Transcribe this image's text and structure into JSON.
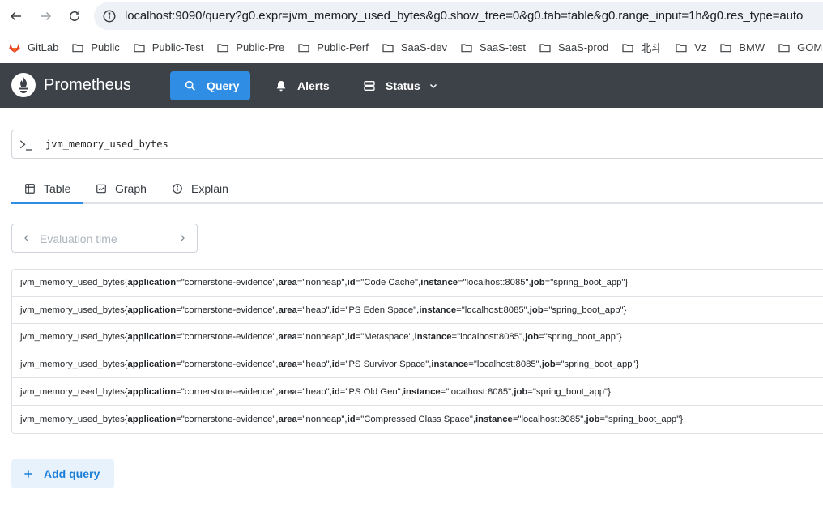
{
  "browser": {
    "url": "localhost:9090/query?g0.expr=jvm_memory_used_bytes&g0.show_tree=0&g0.tab=table&g0.range_input=1h&g0.res_type=auto",
    "bookmarks": [
      "GitLab",
      "Public",
      "Public-Test",
      "Public-Pre",
      "Public-Perf",
      "SaaS-dev",
      "SaaS-test",
      "SaaS-prod",
      "北斗",
      "Vz",
      "BMW",
      "GOM"
    ]
  },
  "navbar": {
    "brand": "Prometheus",
    "query_label": "Query",
    "alerts_label": "Alerts",
    "status_label": "Status"
  },
  "query": {
    "expression": "jvm_memory_used_bytes"
  },
  "tabs": {
    "table": "Table",
    "graph": "Graph",
    "explain": "Explain",
    "active": "Table"
  },
  "eval": {
    "placeholder": "Evaluation time"
  },
  "results": [
    {
      "metric": "jvm_memory_used_bytes",
      "labels": [
        [
          "application",
          "\"cornerstone-evidence\""
        ],
        [
          "area",
          "\"nonheap\""
        ],
        [
          "id",
          "\"Code Cache\""
        ],
        [
          "instance",
          "\"localhost:8085\""
        ],
        [
          "job",
          "\"spring_boot_app\""
        ]
      ]
    },
    {
      "metric": "jvm_memory_used_bytes",
      "labels": [
        [
          "application",
          "\"cornerstone-evidence\""
        ],
        [
          "area",
          "\"heap\""
        ],
        [
          "id",
          "\"PS Eden Space\""
        ],
        [
          "instance",
          "\"localhost:8085\""
        ],
        [
          "job",
          "\"spring_boot_app\""
        ]
      ]
    },
    {
      "metric": "jvm_memory_used_bytes",
      "labels": [
        [
          "application",
          "\"cornerstone-evidence\""
        ],
        [
          "area",
          "\"nonheap\""
        ],
        [
          "id",
          "\"Metaspace\""
        ],
        [
          "instance",
          "\"localhost:8085\""
        ],
        [
          "job",
          "\"spring_boot_app\""
        ]
      ]
    },
    {
      "metric": "jvm_memory_used_bytes",
      "labels": [
        [
          "application",
          "\"cornerstone-evidence\""
        ],
        [
          "area",
          "\"heap\""
        ],
        [
          "id",
          "\"PS Survivor Space\""
        ],
        [
          "instance",
          "\"localhost:8085\""
        ],
        [
          "job",
          "\"spring_boot_app\""
        ]
      ]
    },
    {
      "metric": "jvm_memory_used_bytes",
      "labels": [
        [
          "application",
          "\"cornerstone-evidence\""
        ],
        [
          "area",
          "\"heap\""
        ],
        [
          "id",
          "\"PS Old Gen\""
        ],
        [
          "instance",
          "\"localhost:8085\""
        ],
        [
          "job",
          "\"spring_boot_app\""
        ]
      ]
    },
    {
      "metric": "jvm_memory_used_bytes",
      "labels": [
        [
          "application",
          "\"cornerstone-evidence\""
        ],
        [
          "area",
          "\"nonheap\""
        ],
        [
          "id",
          "\"Compressed Class Space\""
        ],
        [
          "instance",
          "\"localhost:8085\""
        ],
        [
          "job",
          "\"spring_boot_app\""
        ]
      ]
    }
  ],
  "add_query_label": "Add query",
  "colors": {
    "navbar_bg": "#3d4249",
    "accent": "#2f8de4",
    "add_query_bg": "#e7f2fd",
    "add_query_text": "#1c7ed6"
  },
  "icons": {
    "back": "arrow-left-icon",
    "forward": "arrow-right-icon",
    "reload": "reload-icon",
    "site_info": "info-icon",
    "gitlab": "gitlab-icon",
    "folder": "folder-icon",
    "brand": "prometheus-logo-icon",
    "query": "search-icon",
    "alerts": "bell-icon",
    "status": "server-icon",
    "prompt": "terminal-prompt-icon",
    "table": "table-icon",
    "graph": "graph-icon",
    "explain": "info-circle-icon",
    "add": "plus-icon"
  }
}
